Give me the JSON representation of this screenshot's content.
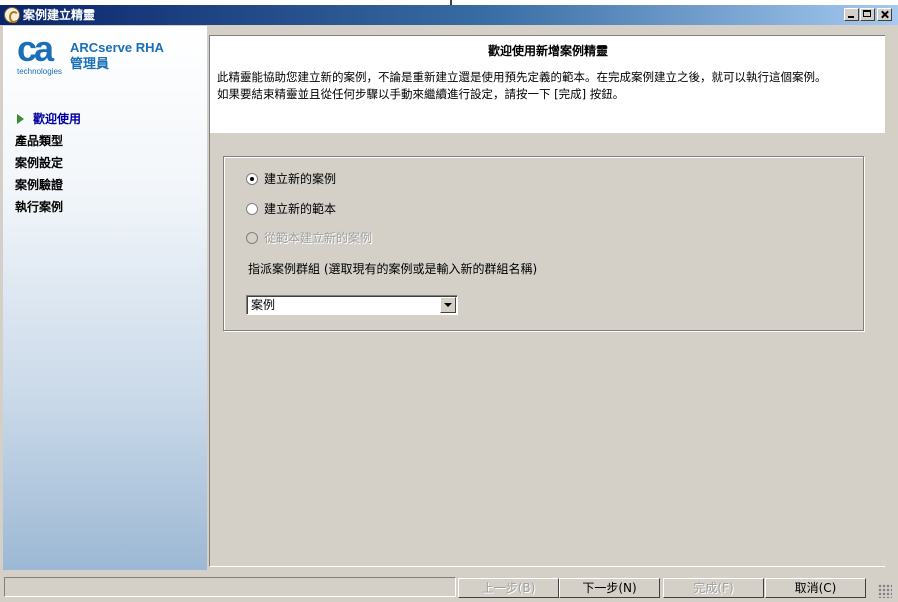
{
  "window": {
    "title": "案例建立精靈",
    "min_icon": "minimize-icon",
    "max_icon": "maximize-icon",
    "close_icon": "close-icon"
  },
  "sidebar": {
    "logo_text": "ca",
    "logo_subtext": "technologies",
    "brand_line1": "ARCserve RHA",
    "brand_line2": "管理員",
    "steps": [
      {
        "label": "歡迎使用",
        "active": true
      },
      {
        "label": "產品類型",
        "active": false
      },
      {
        "label": "案例設定",
        "active": false
      },
      {
        "label": "案例驗證",
        "active": false
      },
      {
        "label": "執行案例",
        "active": false
      }
    ]
  },
  "header": {
    "title": "歡迎使用新增案例精靈",
    "desc_line1": "此精靈能協助您建立新的案例，不論是重新建立還是使用預先定義的範本。在完成案例建立之後，就可以執行這個案例。",
    "desc_line2": "如果要結束精靈並且從任何步驟以手動來繼續進行設定，請按一下 [完成] 按鈕。"
  },
  "options": {
    "radio_new_scenario": "建立新的案例",
    "radio_new_template": "建立新的範本",
    "radio_from_template": "從範本建立新的案例",
    "selected": "radio_new_scenario",
    "group_label": "指派案例群組 (選取現有的案例或是輸入新的群組名稱)",
    "group_value": "案例"
  },
  "footer": {
    "back_label": "上一步(B)",
    "next_label": "下一步(N)",
    "finish_label": "完成(F)",
    "cancel_label": "取消(C)"
  },
  "colors": {
    "titlebar_start": "#0a246a",
    "titlebar_end": "#a6caf0",
    "brand": "#1a6fb8",
    "active_step": "#0000a0",
    "arrow": "#3c8a2e"
  }
}
